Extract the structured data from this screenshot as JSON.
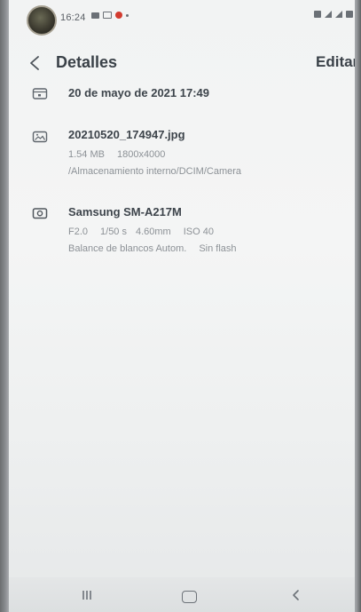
{
  "status_bar": {
    "time": "16:24",
    "icons_left": [
      "message-icon",
      "gallery-icon",
      "record-icon",
      "dot-icon"
    ],
    "icons_right": [
      "alarm-icon",
      "wifi-icon",
      "signal-icon",
      "battery-icon"
    ]
  },
  "header": {
    "title": "Detalles",
    "edit_label": "Editar"
  },
  "details": {
    "date": {
      "icon": "calendar-icon",
      "title": "20 de mayo de 2021 17:49"
    },
    "file": {
      "icon": "image-icon",
      "name": "20210520_174947.jpg",
      "size": "1.54 MB",
      "resolution": "1800x4000",
      "path": "/Almacenamiento interno/DCIM/Camera"
    },
    "camera": {
      "icon": "camera-icon",
      "model": "Samsung SM-A217M",
      "aperture": "F2.0",
      "shutter": "1/50 s",
      "focal_length": "4.60mm",
      "iso": "ISO 40",
      "white_balance": "Balance de blancos Autom.",
      "flash": "Sin flash"
    }
  },
  "nav_bar": {
    "icons": [
      "recent-apps-icon",
      "home-icon",
      "back-icon"
    ]
  },
  "colors": {
    "text_primary": "#3d444b",
    "text_secondary": "#8c9196",
    "background": "#f2f3f3",
    "accent_red": "#d23b2f"
  }
}
